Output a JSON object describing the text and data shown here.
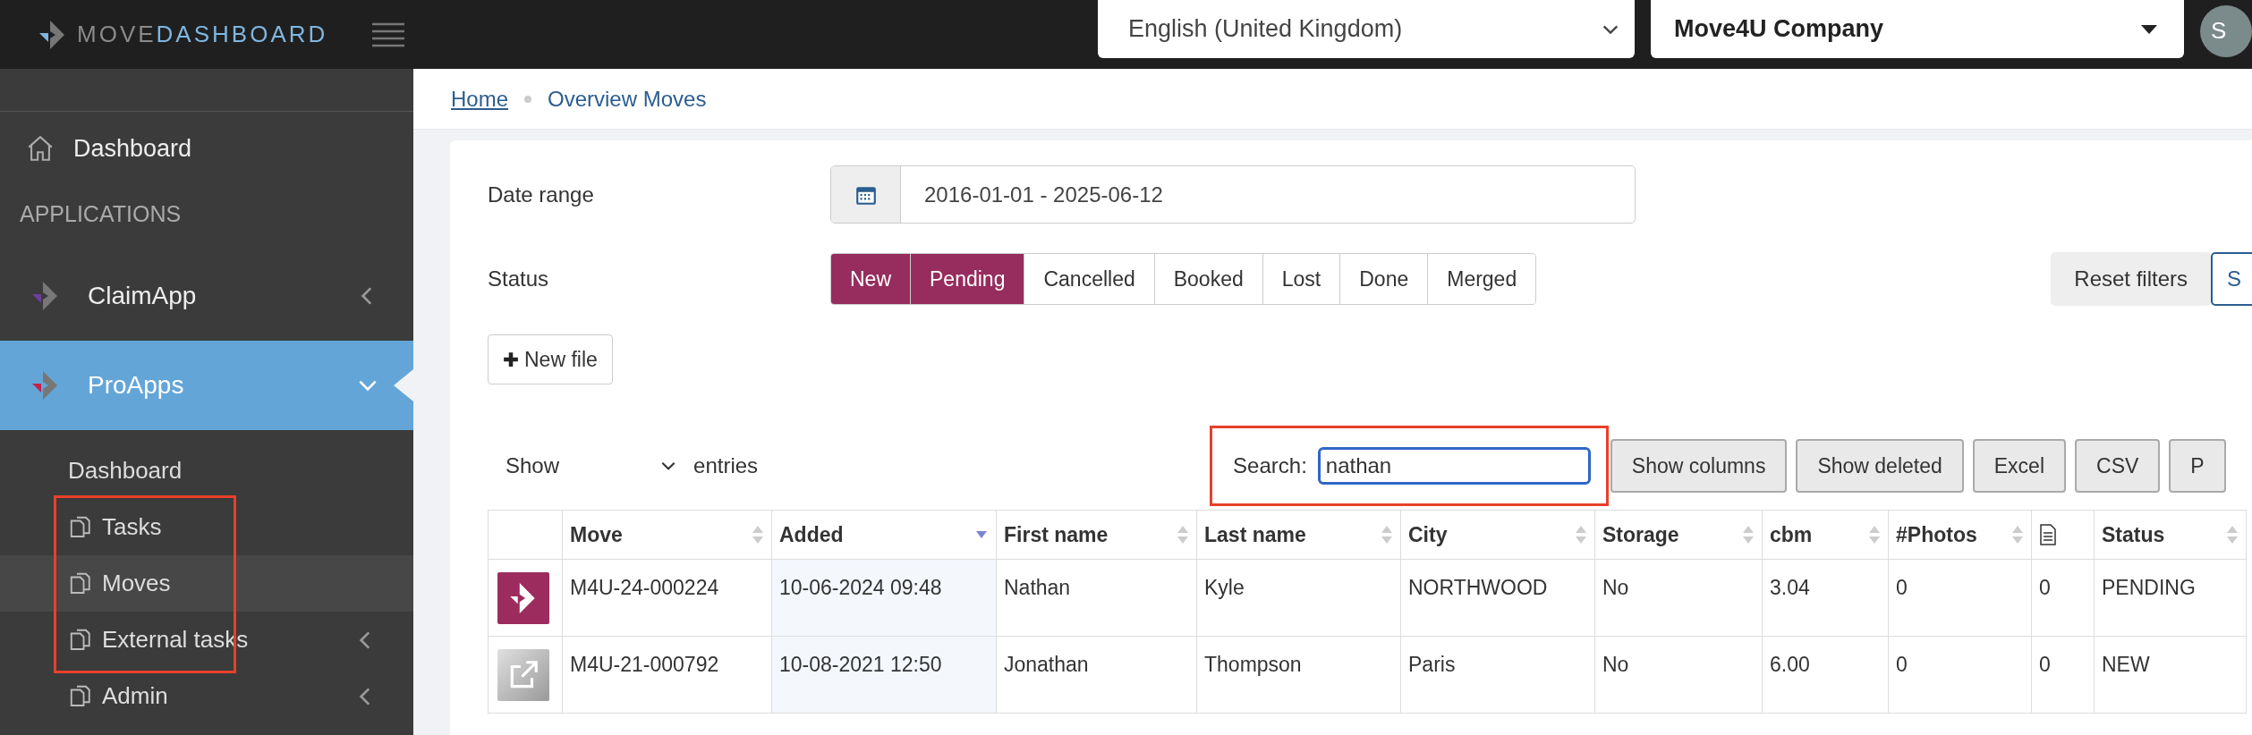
{
  "header": {
    "logo": {
      "light": "MOVE",
      "accent": "DASHBOARD"
    },
    "language": "English (United Kingdom)",
    "company": "Move4U Company",
    "avatar": "S"
  },
  "sidebar": {
    "items": [
      {
        "kind": "home",
        "label": "Dashboard"
      },
      {
        "kind": "section",
        "label": "APPLICATIONS"
      },
      {
        "kind": "app",
        "label": "ClaimApp",
        "color": "#6b3fa0",
        "selected": false,
        "expanded": false
      },
      {
        "kind": "app",
        "label": "ProApps",
        "color": "#c0234e",
        "selected": true,
        "expanded": true,
        "children": [
          {
            "kind": "plain",
            "label": "Dashboard",
            "selected": false,
            "submenu": false,
            "framed": false
          },
          {
            "kind": "page",
            "label": "Tasks",
            "selected": false,
            "submenu": false,
            "framed": true
          },
          {
            "kind": "page",
            "label": "Moves",
            "selected": true,
            "submenu": false,
            "framed": true
          },
          {
            "kind": "page",
            "label": "External tasks",
            "selected": false,
            "submenu": true,
            "framed": true
          },
          {
            "kind": "page",
            "label": "Admin",
            "selected": false,
            "submenu": true,
            "framed": false
          }
        ]
      }
    ]
  },
  "breadcrumb": [
    {
      "label": "Home",
      "link": true
    },
    {
      "label": "Overview Moves",
      "link": false
    }
  ],
  "filters": {
    "date_label": "Date range",
    "date_value": "2016-01-01 - 2025-06-12",
    "status_label": "Status",
    "statuses": [
      {
        "label": "New",
        "selected": true
      },
      {
        "label": "Pending",
        "selected": true
      },
      {
        "label": "Cancelled",
        "selected": false
      },
      {
        "label": "Booked",
        "selected": false
      },
      {
        "label": "Lost",
        "selected": false
      },
      {
        "label": "Done",
        "selected": false
      },
      {
        "label": "Merged",
        "selected": false
      }
    ],
    "reset": "Reset filters",
    "show": "S",
    "new_file": "New file"
  },
  "controls": {
    "show": "Show",
    "entries": "entries",
    "search_label": "Search:",
    "search_value": "nathan",
    "framed": true,
    "buttons": [
      "Show columns",
      "Show deleted",
      "Excel",
      "CSV",
      "P"
    ]
  },
  "table": {
    "columns": [
      {
        "kind": "text",
        "label": "Move",
        "sorted": false
      },
      {
        "kind": "text",
        "label": "Added",
        "sorted": true
      },
      {
        "kind": "text",
        "label": "First name",
        "sorted": false
      },
      {
        "kind": "text",
        "label": "Last name",
        "sorted": false
      },
      {
        "kind": "text",
        "label": "City",
        "sorted": false
      },
      {
        "kind": "text",
        "label": "Storage",
        "sorted": false
      },
      {
        "kind": "text",
        "label": "cbm",
        "sorted": false
      },
      {
        "kind": "text",
        "label": "#Photos",
        "sorted": false
      },
      {
        "kind": "doc"
      },
      {
        "kind": "text",
        "label": "Status",
        "sorted": false
      }
    ],
    "rows": [
      {
        "kind": "brand",
        "cells": [
          "M4U-24-000224",
          "10-06-2024 09:48",
          "Nathan",
          "Kyle",
          "NORTHWOOD",
          "No",
          "3.04",
          "0",
          "0",
          "PENDING"
        ]
      },
      {
        "kind": "external",
        "cells": [
          "M4U-21-000792",
          "10-08-2021 12:50",
          "Jonathan",
          "Thompson",
          "Paris",
          "No",
          "6.00",
          "0",
          "0",
          "NEW"
        ]
      }
    ]
  }
}
